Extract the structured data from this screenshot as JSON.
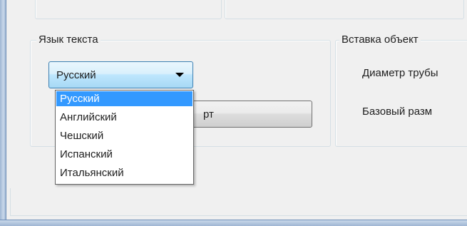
{
  "language_group": {
    "legend": "Язык текста",
    "combo_value": "Русский",
    "options": [
      "Русский",
      "Английский",
      "Чешский",
      "Испанский",
      "Итальянский"
    ],
    "selected_index": 0,
    "button_label_visible": "рт"
  },
  "insert_group": {
    "legend": "Вставка объект",
    "diameter_label": "Диаметр трубы",
    "base_size_label": "Базовый разм"
  },
  "colors": {
    "selection": "#3399ff",
    "combo_border": "#3c7fb1",
    "dialog_bg": "#f0f0f0"
  }
}
